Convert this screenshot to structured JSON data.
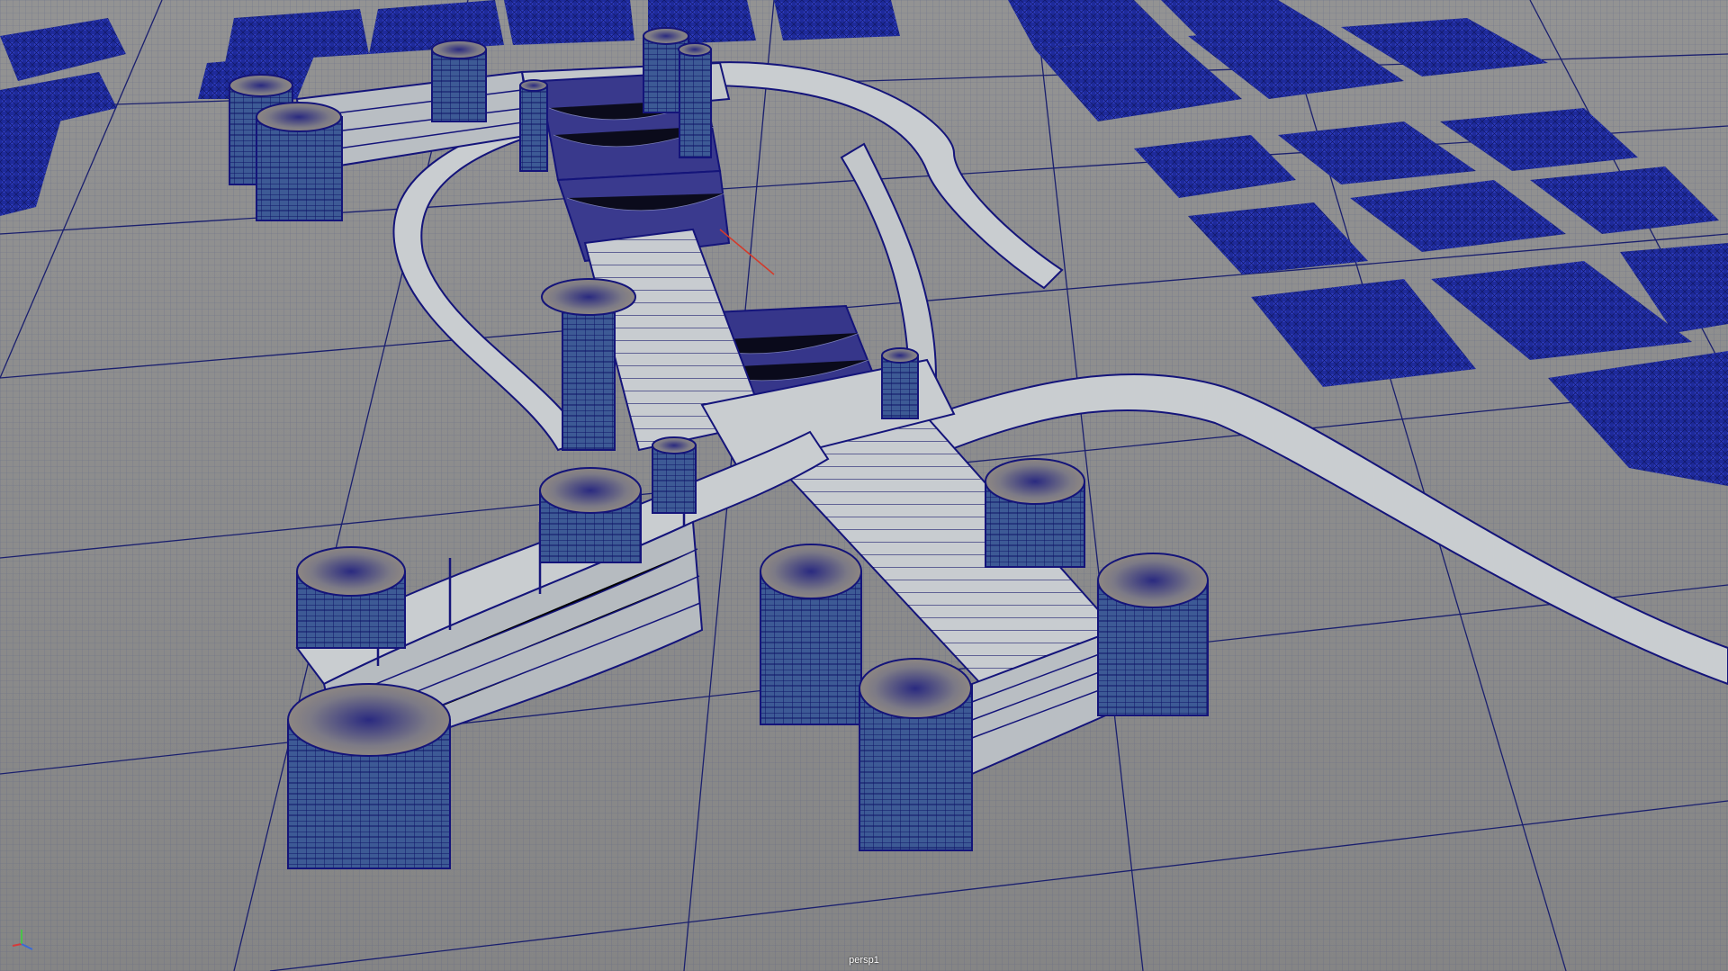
{
  "viewport": {
    "camera_name": "persp1",
    "display_mode": "wireframe-on-shaded",
    "colors": {
      "background": "#8e8e8e",
      "grid_line": "#1a1f6e",
      "wireframe": "#14147a",
      "surface": "#c9cdd0",
      "glass": "#4a6ea8",
      "cap": "#8b8270",
      "seat": "#1e2a9a"
    }
  },
  "axis_gizmo": {
    "x_color": "#d63a3a",
    "y_color": "#4ac24a",
    "z_color": "#3a6ad6"
  }
}
